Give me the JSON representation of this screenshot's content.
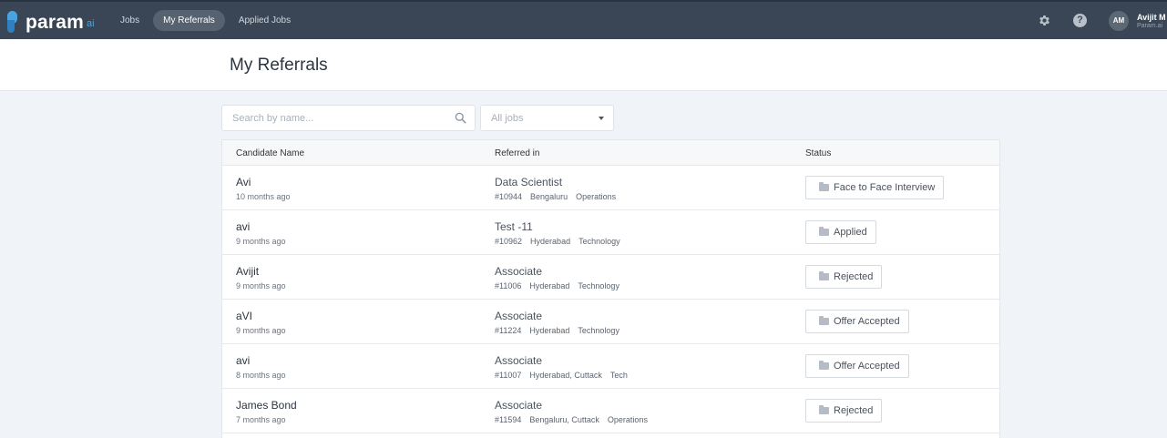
{
  "app": {
    "logo_text": "param",
    "logo_suffix": "ai"
  },
  "nav": {
    "items": [
      {
        "label": "Jobs",
        "active": false
      },
      {
        "label": "My Referrals",
        "active": true
      },
      {
        "label": "Applied Jobs",
        "active": false
      }
    ],
    "settings_icon": "gear-icon",
    "help_icon": "help-icon",
    "help_glyph": "?",
    "user": {
      "initials": "AM",
      "name": "Avijit M",
      "org": "Param.ai"
    }
  },
  "page": {
    "title": "My Referrals"
  },
  "filters": {
    "search_placeholder": "Search by name...",
    "jobs_select": "All jobs"
  },
  "table": {
    "columns": [
      "Candidate Name",
      "Referred in",
      "Status"
    ],
    "rows": [
      {
        "name": "Avi",
        "time": "10 months ago",
        "job": "Data Scientist",
        "job_id": "#10944",
        "location": "Bengaluru",
        "dept": "Operations",
        "status": "Face to Face Interview"
      },
      {
        "name": "avi",
        "time": "9 months ago",
        "job": "Test -11",
        "job_id": "#10962",
        "location": "Hyderabad",
        "dept": "Technology",
        "status": "Applied"
      },
      {
        "name": "Avijit",
        "time": "9 months ago",
        "job": "Associate",
        "job_id": "#11006",
        "location": "Hyderabad",
        "dept": "Technology",
        "status": "Rejected"
      },
      {
        "name": "aVI",
        "time": "9 months ago",
        "job": "Associate",
        "job_id": "#11224",
        "location": "Hyderabad",
        "dept": "Technology",
        "status": "Offer Accepted"
      },
      {
        "name": "avi",
        "time": "8 months ago",
        "job": "Associate",
        "job_id": "#11007",
        "location": "Hyderabad, Cuttack",
        "dept": "Tech",
        "status": "Offer Accepted"
      },
      {
        "name": "James Bond",
        "time": "7 months ago",
        "job": "Associate",
        "job_id": "#11594",
        "location": "Bengaluru, Cuttack",
        "dept": "Operations",
        "status": "Rejected"
      }
    ]
  }
}
